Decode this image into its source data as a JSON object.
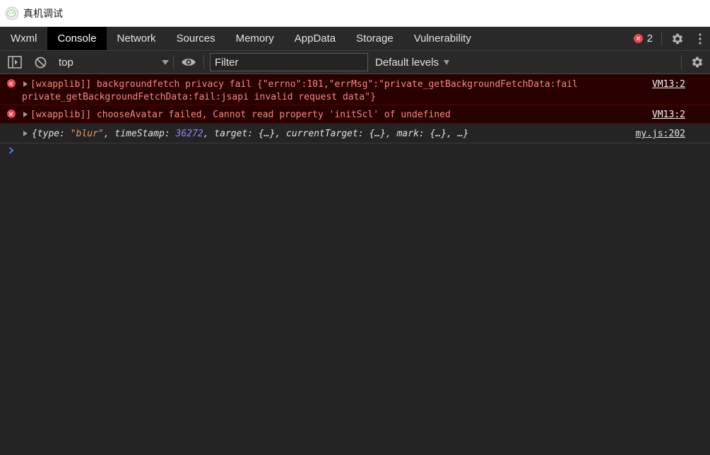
{
  "window": {
    "title": "真机调试"
  },
  "tabs": [
    {
      "label": "Wxml"
    },
    {
      "label": "Console"
    },
    {
      "label": "Network"
    },
    {
      "label": "Sources"
    },
    {
      "label": "Memory"
    },
    {
      "label": "AppData"
    },
    {
      "label": "Storage"
    },
    {
      "label": "Vulnerability"
    }
  ],
  "active_tab": "Console",
  "error_count": "2",
  "toolbar": {
    "context": "top",
    "filter_placeholder": "Filter",
    "levels_label": "Default levels"
  },
  "messages": [
    {
      "level": "error",
      "line1": "[wxapplib]] backgroundfetch privacy fail {\"errno\":101,\"errMsg\":\"private_getBackgroundFetchData:fail",
      "line2": "private_getBackgroundFetchData:fail:jsapi invalid request data\"}",
      "source": "VM13:2"
    },
    {
      "level": "error",
      "line1": "[wxapplib]] chooseAvatar failed, Cannot read property 'initScl' of undefined",
      "source": "VM13:2"
    },
    {
      "level": "log",
      "object": {
        "open": "{",
        "k_type": "type: ",
        "v_type": "\"blur\"",
        "k_ts": ", timeStamp: ",
        "v_ts": "36272",
        "rest": ", target: {…}, currentTarget: {…}, mark: {…}, …}"
      },
      "source": "my.js:202"
    }
  ],
  "colors": {
    "background": "#242424",
    "tabbar": "#292929",
    "active_tab": "#000000",
    "error_bg": "#290000",
    "error_text": "#f28b82",
    "prompt": "#4a9df8"
  }
}
